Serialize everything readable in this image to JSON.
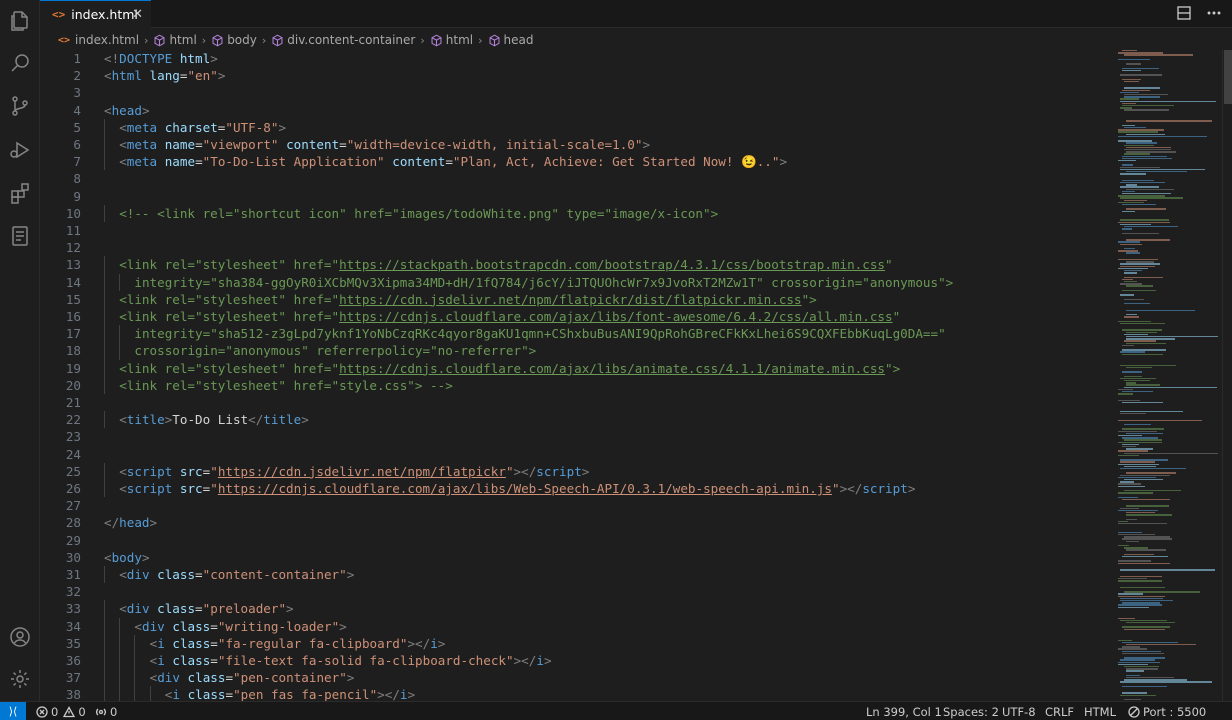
{
  "tabs": [
    {
      "label": "index.html",
      "icon": "html-file-icon",
      "active": true
    }
  ],
  "breadcrumbs": [
    "index.html",
    "html",
    "body",
    "div.content-container",
    "html",
    "head"
  ],
  "editor": {
    "lines": [
      {
        "n": "1",
        "indent": 0,
        "tokens": [
          [
            "tag",
            "<!"
          ],
          [
            "name",
            "DOCTYPE"
          ],
          [
            "text",
            " "
          ],
          [
            "attr",
            "html"
          ],
          [
            "tag",
            ">"
          ]
        ]
      },
      {
        "n": "2",
        "indent": 0,
        "tokens": [
          [
            "tag",
            "<"
          ],
          [
            "name",
            "html"
          ],
          [
            "text",
            " "
          ],
          [
            "attr",
            "lang"
          ],
          [
            "text",
            "="
          ],
          [
            "str",
            "\"en\""
          ],
          [
            "tag",
            ">"
          ]
        ]
      },
      {
        "n": "3",
        "indent": 0,
        "tokens": []
      },
      {
        "n": "4",
        "indent": 0,
        "tokens": [
          [
            "tag",
            "<"
          ],
          [
            "name",
            "head"
          ],
          [
            "tag",
            ">"
          ]
        ]
      },
      {
        "n": "5",
        "indent": 1,
        "tokens": [
          [
            "tag",
            "<"
          ],
          [
            "name",
            "meta"
          ],
          [
            "text",
            " "
          ],
          [
            "attr",
            "charset"
          ],
          [
            "text",
            "="
          ],
          [
            "str",
            "\"UTF-8\""
          ],
          [
            "tag",
            ">"
          ]
        ]
      },
      {
        "n": "6",
        "indent": 1,
        "tokens": [
          [
            "tag",
            "<"
          ],
          [
            "name",
            "meta"
          ],
          [
            "text",
            " "
          ],
          [
            "attr",
            "name"
          ],
          [
            "text",
            "="
          ],
          [
            "str",
            "\"viewport\""
          ],
          [
            "text",
            " "
          ],
          [
            "attr",
            "content"
          ],
          [
            "text",
            "="
          ],
          [
            "str",
            "\"width=device-width, initial-scale=1.0\""
          ],
          [
            "tag",
            ">"
          ]
        ]
      },
      {
        "n": "7",
        "indent": 1,
        "tokens": [
          [
            "tag",
            "<"
          ],
          [
            "name",
            "meta"
          ],
          [
            "text",
            " "
          ],
          [
            "attr",
            "name"
          ],
          [
            "text",
            "="
          ],
          [
            "str",
            "\"To-Do-List Application\""
          ],
          [
            "text",
            " "
          ],
          [
            "attr",
            "content"
          ],
          [
            "text",
            "="
          ],
          [
            "str",
            "\"Plan, Act, Achieve: Get Started Now! 😉..\""
          ],
          [
            "tag",
            ">"
          ]
        ]
      },
      {
        "n": "8",
        "indent": 0,
        "tokens": []
      },
      {
        "n": "9",
        "indent": 0,
        "tokens": []
      },
      {
        "n": "10",
        "indent": 1,
        "tokens": [
          [
            "cmt",
            "<!-- <link rel=\"shortcut icon\" href=\"images/todoWhite.png\" type=\"image/x-icon\">"
          ]
        ]
      },
      {
        "n": "11",
        "indent": 0,
        "tokens": []
      },
      {
        "n": "12",
        "indent": 0,
        "tokens": []
      },
      {
        "n": "13",
        "indent": 1,
        "tokens": [
          [
            "cmt",
            "<link rel=\"stylesheet\" href=\""
          ],
          [
            "curl",
            "https://stackpath.bootstrapcdn.com/bootstrap/4.3.1/css/bootstrap.min.css"
          ],
          [
            "cmt",
            "\""
          ]
        ]
      },
      {
        "n": "14",
        "indent": 2,
        "tokens": [
          [
            "cmt",
            "integrity=\"sha384-ggOyR0iXCbMQv3Xipma34MD+dH/1fQ784/j6cY/iJTQUOhcWr7x9JvoRxT2MZw1T\" crossorigin=\"anonymous\">"
          ]
        ]
      },
      {
        "n": "15",
        "indent": 1,
        "tokens": [
          [
            "cmt",
            "<link rel=\"stylesheet\" href=\""
          ],
          [
            "curl",
            "https://cdn.jsdelivr.net/npm/flatpickr/dist/flatpickr.min.css"
          ],
          [
            "cmt",
            "\">"
          ]
        ]
      },
      {
        "n": "16",
        "indent": 1,
        "tokens": [
          [
            "cmt",
            "<link rel=\"stylesheet\" href=\""
          ],
          [
            "curl",
            "https://cdnjs.cloudflare.com/ajax/libs/font-awesome/6.4.2/css/all.min.css"
          ],
          [
            "cmt",
            "\""
          ]
        ]
      },
      {
        "n": "17",
        "indent": 2,
        "tokens": [
          [
            "cmt",
            "integrity=\"sha512-z3gLpd7yknf1YoNbCzqRKc4qyor8gaKU1qmn+CShxbuBusANI9QpRohGBreCFkKxLhei6S9CQXFEbbKuqLg0DA==\""
          ]
        ]
      },
      {
        "n": "18",
        "indent": 2,
        "tokens": [
          [
            "cmt",
            "crossorigin=\"anonymous\" referrerpolicy=\"no-referrer\">"
          ]
        ]
      },
      {
        "n": "19",
        "indent": 1,
        "tokens": [
          [
            "cmt",
            "<link rel=\"stylesheet\" href=\""
          ],
          [
            "curl",
            "https://cdnjs.cloudflare.com/ajax/libs/animate.css/4.1.1/animate.min.css"
          ],
          [
            "cmt",
            "\">"
          ]
        ]
      },
      {
        "n": "20",
        "indent": 1,
        "tokens": [
          [
            "cmt",
            "<link rel=\"stylesheet\" href=\"style.css\"> -->"
          ]
        ]
      },
      {
        "n": "21",
        "indent": 0,
        "tokens": []
      },
      {
        "n": "22",
        "indent": 1,
        "tokens": [
          [
            "tag",
            "<"
          ],
          [
            "name",
            "title"
          ],
          [
            "tag",
            ">"
          ],
          [
            "text",
            "To-Do List"
          ],
          [
            "tag",
            "</"
          ],
          [
            "name",
            "title"
          ],
          [
            "tag",
            ">"
          ]
        ]
      },
      {
        "n": "23",
        "indent": 0,
        "tokens": []
      },
      {
        "n": "24",
        "indent": 0,
        "tokens": []
      },
      {
        "n": "25",
        "indent": 1,
        "tokens": [
          [
            "tag",
            "<"
          ],
          [
            "name",
            "script"
          ],
          [
            "text",
            " "
          ],
          [
            "attr",
            "src"
          ],
          [
            "text",
            "="
          ],
          [
            "str",
            "\""
          ],
          [
            "url",
            "https://cdn.jsdelivr.net/npm/flatpickr"
          ],
          [
            "str",
            "\""
          ],
          [
            "tag",
            "></"
          ],
          [
            "name",
            "script"
          ],
          [
            "tag",
            ">"
          ]
        ]
      },
      {
        "n": "26",
        "indent": 1,
        "tokens": [
          [
            "tag",
            "<"
          ],
          [
            "name",
            "script"
          ],
          [
            "text",
            " "
          ],
          [
            "attr",
            "src"
          ],
          [
            "text",
            "="
          ],
          [
            "str",
            "\""
          ],
          [
            "url",
            "https://cdnjs.cloudflare.com/ajax/libs/Web-Speech-API/0.3.1/web-speech-api.min.js"
          ],
          [
            "str",
            "\""
          ],
          [
            "tag",
            "></"
          ],
          [
            "name",
            "script"
          ],
          [
            "tag",
            ">"
          ]
        ]
      },
      {
        "n": "27",
        "indent": 0,
        "tokens": []
      },
      {
        "n": "28",
        "indent": 0,
        "tokens": [
          [
            "tag",
            "</"
          ],
          [
            "name",
            "head"
          ],
          [
            "tag",
            ">"
          ]
        ]
      },
      {
        "n": "29",
        "indent": 0,
        "tokens": []
      },
      {
        "n": "30",
        "indent": 0,
        "tokens": [
          [
            "tag",
            "<"
          ],
          [
            "name",
            "body"
          ],
          [
            "tag",
            ">"
          ]
        ]
      },
      {
        "n": "31",
        "indent": 1,
        "tokens": [
          [
            "tag",
            "<"
          ],
          [
            "name",
            "div"
          ],
          [
            "text",
            " "
          ],
          [
            "attr",
            "class"
          ],
          [
            "text",
            "="
          ],
          [
            "str",
            "\"content-container\""
          ],
          [
            "tag",
            ">"
          ]
        ]
      },
      {
        "n": "32",
        "indent": 0,
        "tokens": []
      },
      {
        "n": "33",
        "indent": 1,
        "tokens": [
          [
            "tag",
            "<"
          ],
          [
            "name",
            "div"
          ],
          [
            "text",
            " "
          ],
          [
            "attr",
            "class"
          ],
          [
            "text",
            "="
          ],
          [
            "str",
            "\"preloader\""
          ],
          [
            "tag",
            ">"
          ]
        ]
      },
      {
        "n": "34",
        "indent": 2,
        "tokens": [
          [
            "tag",
            "<"
          ],
          [
            "name",
            "div"
          ],
          [
            "text",
            " "
          ],
          [
            "attr",
            "class"
          ],
          [
            "text",
            "="
          ],
          [
            "str",
            "\"writing-loader\""
          ],
          [
            "tag",
            ">"
          ]
        ]
      },
      {
        "n": "35",
        "indent": 3,
        "tokens": [
          [
            "tag",
            "<"
          ],
          [
            "name",
            "i"
          ],
          [
            "text",
            " "
          ],
          [
            "attr",
            "class"
          ],
          [
            "text",
            "="
          ],
          [
            "str",
            "\"fa-regular fa-clipboard\""
          ],
          [
            "tag",
            "></"
          ],
          [
            "name",
            "i"
          ],
          [
            "tag",
            ">"
          ]
        ]
      },
      {
        "n": "36",
        "indent": 3,
        "tokens": [
          [
            "tag",
            "<"
          ],
          [
            "name",
            "i"
          ],
          [
            "text",
            " "
          ],
          [
            "attr",
            "class"
          ],
          [
            "text",
            "="
          ],
          [
            "str",
            "\"file-text fa-solid fa-clipboard-check\""
          ],
          [
            "tag",
            "></"
          ],
          [
            "name",
            "i"
          ],
          [
            "tag",
            ">"
          ]
        ]
      },
      {
        "n": "37",
        "indent": 3,
        "tokens": [
          [
            "tag",
            "<"
          ],
          [
            "name",
            "div"
          ],
          [
            "text",
            " "
          ],
          [
            "attr",
            "class"
          ],
          [
            "text",
            "="
          ],
          [
            "str",
            "\"pen-container\""
          ],
          [
            "tag",
            ">"
          ]
        ]
      },
      {
        "n": "38",
        "indent": 4,
        "tokens": [
          [
            "tag",
            "<"
          ],
          [
            "name",
            "i"
          ],
          [
            "text",
            " "
          ],
          [
            "attr",
            "class"
          ],
          [
            "text",
            "="
          ],
          [
            "str",
            "\"pen fas fa-pencil\""
          ],
          [
            "tag",
            "></"
          ],
          [
            "name",
            "i"
          ],
          [
            "tag",
            ">"
          ]
        ]
      }
    ]
  },
  "status_bar": {
    "errors": "0",
    "warnings": "0",
    "ports": "0",
    "position": "Ln 399, Col 1",
    "spaces": "Spaces: 2",
    "encoding": "UTF-8",
    "eol": "CRLF",
    "language": "HTML",
    "port": "Port : 5500"
  },
  "colors": {
    "accent": "#0078d4",
    "background": "#1e1e1e",
    "tag_name": "#569cd6",
    "attribute": "#9cdcfe",
    "string": "#ce9178",
    "comment": "#6a9955"
  }
}
